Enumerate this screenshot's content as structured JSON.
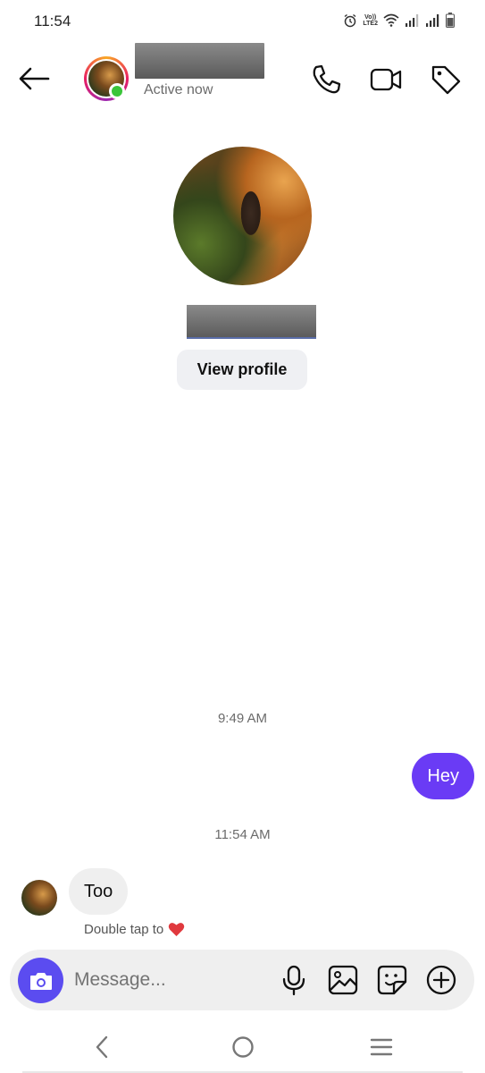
{
  "status_bar": {
    "time": "11:54",
    "network_top": "Vo))",
    "network_bottom": "LTE2",
    "icons": [
      "alarm-icon",
      "volte-icon",
      "wifi-icon",
      "signal-icon",
      "signal-icon",
      "battery-icon"
    ]
  },
  "header": {
    "back_icon": "arrow-left-icon",
    "contact_name": "",
    "status": "Active now",
    "actions": [
      "phone-icon",
      "video-camera-icon",
      "tag-icon"
    ]
  },
  "profile": {
    "name": "",
    "view_profile_label": "View profile"
  },
  "messages": [
    {
      "type": "timestamp",
      "text": "9:49 AM"
    },
    {
      "type": "outgoing",
      "text": "Hey"
    },
    {
      "type": "timestamp",
      "text": "11:54 AM"
    },
    {
      "type": "incoming",
      "text": "Too",
      "hint": "Double tap to"
    }
  ],
  "composer": {
    "placeholder": "Message...",
    "icons": [
      "camera-icon",
      "microphone-icon",
      "gallery-icon",
      "sticker-icon",
      "plus-circle-icon"
    ]
  },
  "nav_bar": {
    "icons": [
      "nav-back-icon",
      "nav-home-icon",
      "nav-recents-icon"
    ]
  },
  "colors": {
    "outgoing_bubble": "#6a3bf5",
    "incoming_bubble": "#efefef",
    "camera_button": "#5b4cf0",
    "online_dot": "#3ac53a",
    "heart": "#e0393e"
  }
}
